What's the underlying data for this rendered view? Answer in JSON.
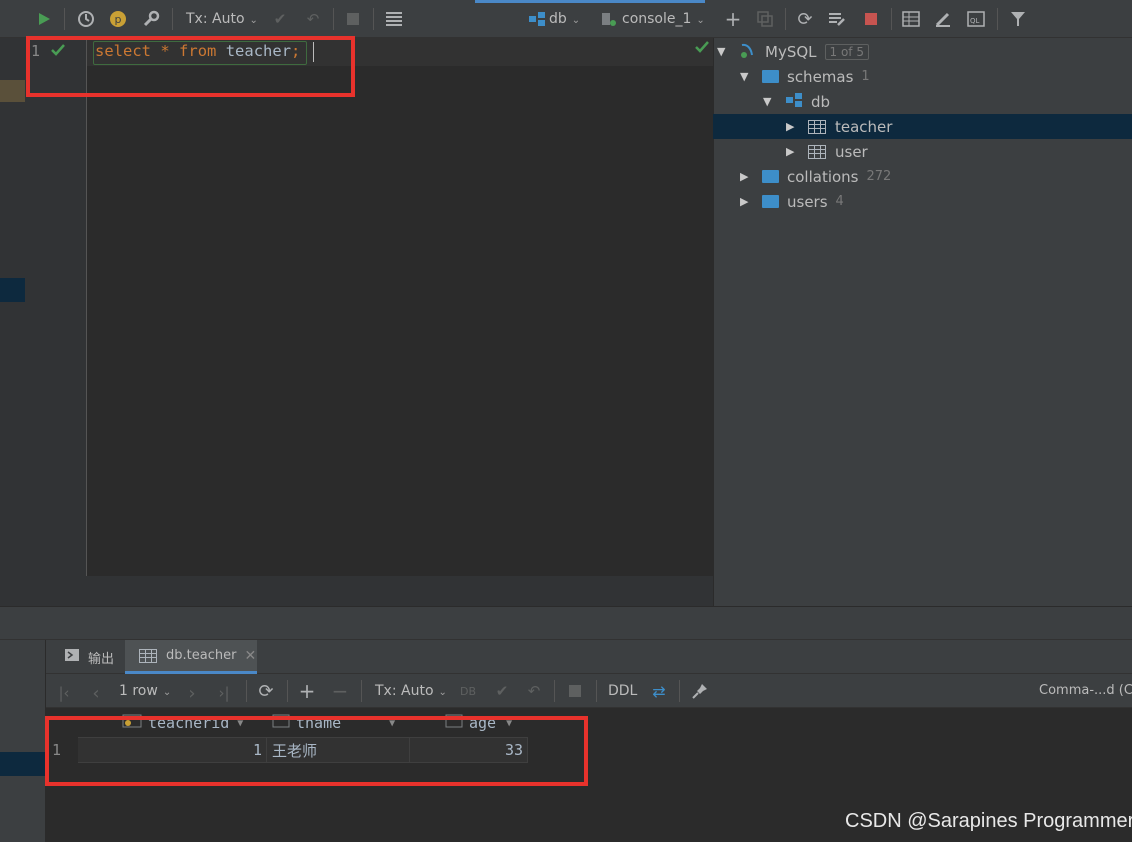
{
  "toolbar": {
    "tx_mode": "Tx: Auto",
    "datasource": "db",
    "console": "console_1",
    "accent_color": "#4a88c7"
  },
  "editor": {
    "line_number": "1",
    "code": {
      "kw_select": "select",
      "star": "*",
      "kw_from": "from",
      "table": "teacher",
      "semicolon": ";"
    },
    "highlight_color": "#e8322c"
  },
  "tree": {
    "root": {
      "label": "MySQL",
      "badge": "1 of 5"
    },
    "schemas": {
      "label": "schemas",
      "count": "1"
    },
    "db": {
      "label": "db"
    },
    "tables": [
      {
        "label": "teacher"
      },
      {
        "label": "user"
      }
    ],
    "collations": {
      "label": "collations",
      "count": "272"
    },
    "users": {
      "label": "users",
      "count": "4"
    }
  },
  "bottom_tabs": [
    {
      "label": "输出"
    },
    {
      "label": "db.teacher"
    }
  ],
  "results_toolbar": {
    "rows_label": "1 row",
    "tx_mode": "Tx: Auto",
    "ddl_label": "DDL",
    "right_label": "Comma-...d (CS"
  },
  "results": {
    "columns": [
      "teacherid",
      "tname",
      "age"
    ],
    "rows": [
      {
        "row_no": "1",
        "teacherid": "1",
        "tname": "王老师",
        "age": "33"
      }
    ]
  },
  "watermark": "CSDN @Sarapines Programmer"
}
